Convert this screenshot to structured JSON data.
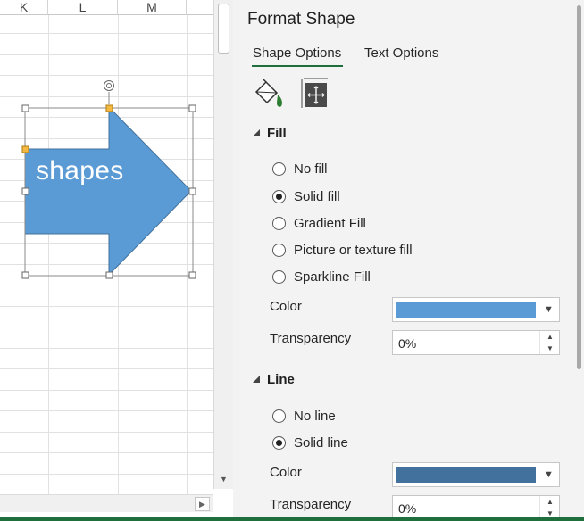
{
  "sheet": {
    "columns": [
      "K",
      "L",
      "M"
    ],
    "shape_text": "shapes"
  },
  "pane": {
    "title": "Format Shape",
    "tabs": [
      {
        "label": "Shape Options",
        "active": true
      },
      {
        "label": "Text Options",
        "active": false
      }
    ],
    "icons": [
      "fill-line-icon",
      "size-properties-icon"
    ],
    "fill": {
      "heading": "Fill",
      "options": [
        {
          "label": "No fill",
          "checked": false
        },
        {
          "label": "Solid fill",
          "checked": true
        },
        {
          "label": "Gradient Fill",
          "checked": false
        },
        {
          "label": "Picture or texture fill",
          "checked": false
        },
        {
          "label": "Sparkline Fill",
          "checked": false
        }
      ],
      "color_label": "Color",
      "color_value": "#5b9bd5",
      "transparency_label": "Transparency",
      "transparency_value": "0%"
    },
    "line": {
      "heading": "Line",
      "options": [
        {
          "label": "No line",
          "checked": false
        },
        {
          "label": "Solid line",
          "checked": true
        }
      ],
      "color_label": "Color",
      "color_value": "#41719c",
      "transparency_label": "Transparency",
      "transparency_value": "0%"
    }
  },
  "colors": {
    "accent": "#1e6f3c",
    "shape_fill": "#5b9bd5",
    "shape_outline": "#41719c"
  }
}
